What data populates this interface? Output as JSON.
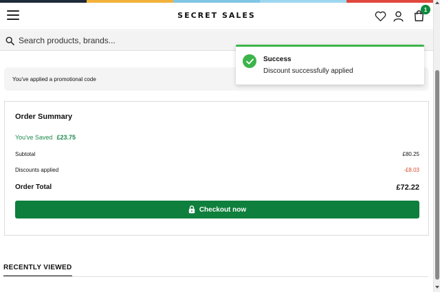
{
  "header": {
    "stripe_colors": [
      "#1e2a3a",
      "#f2b23a",
      "#7fc6e4",
      "#9dd7ef",
      "#e0473d"
    ],
    "logo": "SECRET SALES",
    "cart_count": "1",
    "icons": [
      "menu-icon",
      "heart-icon",
      "user-icon",
      "bag-icon"
    ]
  },
  "search": {
    "placeholder": "Search products, brands..."
  },
  "promo": {
    "message": "You've applied a promotional code"
  },
  "summary": {
    "title": "Order Summary",
    "saved_label": "You've Saved",
    "saved_amount": "£23.75",
    "subtotal_label": "Subtotal",
    "subtotal_value": "£80.25",
    "discounts_label": "Discounts applied",
    "discounts_value": "-£8.03",
    "total_label": "Order Total",
    "total_value": "£72.22",
    "checkout_label": "Checkout now"
  },
  "recently_viewed": {
    "heading": "RECENTLY VIEWED"
  },
  "toast": {
    "title": "Success",
    "message": "Discount successfully applied",
    "accent": "#3cb44b"
  },
  "colors": {
    "brand_green": "#0e7f3c",
    "saved_green": "#1a8a4a",
    "discount_red": "#d94a2b"
  }
}
